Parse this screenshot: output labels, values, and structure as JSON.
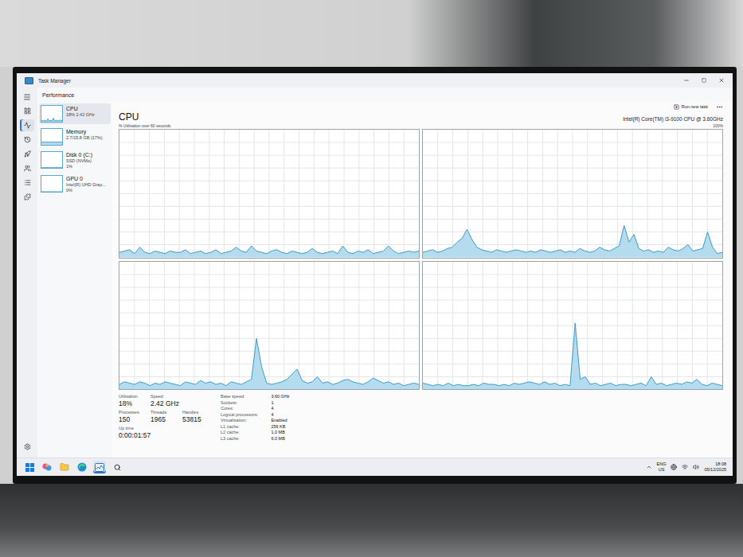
{
  "window": {
    "title": "Task Manager"
  },
  "header": {
    "title": "Performance",
    "run_new_task": "Run new task"
  },
  "nav": [
    {
      "selected": false
    },
    {
      "selected": true
    },
    {
      "selected": false
    },
    {
      "selected": false
    },
    {
      "selected": false
    },
    {
      "selected": false
    },
    {
      "selected": false
    }
  ],
  "resources": [
    {
      "name": "CPU",
      "details": [
        "18% 2.42 GHz"
      ],
      "selected": true,
      "values": [
        5,
        8,
        4,
        10,
        6,
        5,
        18,
        7,
        6,
        9,
        5,
        22,
        8,
        6,
        10,
        7,
        5,
        12,
        6,
        8
      ]
    },
    {
      "name": "Memory",
      "details": [
        "2.7/15.8 GB (17%)"
      ],
      "selected": false,
      "values": [
        17,
        17,
        17,
        17,
        17,
        17,
        17,
        17,
        17,
        17,
        17,
        17,
        17,
        17,
        17,
        17,
        17,
        17,
        17,
        17
      ]
    },
    {
      "name": "Disk 0 (C:)",
      "details": [
        "SSD (NVMe)",
        "1%"
      ],
      "selected": false,
      "values": [
        1,
        1,
        2,
        1,
        1,
        3,
        1,
        1,
        1,
        2,
        1,
        1,
        1,
        1,
        4,
        1,
        1,
        1,
        2,
        1
      ]
    },
    {
      "name": "GPU 0",
      "details": [
        "Intel(R) UHD Grap...",
        "0%"
      ],
      "selected": false,
      "values": [
        0,
        0,
        0,
        0,
        0,
        0,
        0,
        0,
        0,
        0,
        0,
        0,
        0,
        0,
        0,
        0,
        0,
        0,
        0,
        0
      ]
    }
  ],
  "cpu": {
    "title": "CPU",
    "subtitle": "% Utilisation over 60 seconds",
    "model": "Intel(R) Core(TM) i3-9100 CPU @ 3.60GHz",
    "max_label": "100%",
    "cores": [
      {
        "values": [
          4,
          5,
          6,
          3,
          8,
          4,
          3,
          5,
          4,
          3,
          5,
          4,
          4,
          6,
          3,
          4,
          5,
          3,
          4,
          6,
          3,
          4,
          5,
          8,
          5,
          4,
          9,
          5,
          4,
          3,
          5,
          6,
          4,
          3,
          5,
          4,
          3,
          4,
          7,
          4,
          3,
          4,
          5,
          3,
          9,
          4,
          3,
          5,
          4,
          6,
          3,
          4,
          5,
          9,
          5,
          3,
          4,
          5,
          4,
          5
        ]
      },
      {
        "values": [
          4,
          5,
          6,
          4,
          5,
          7,
          8,
          12,
          15,
          22,
          14,
          8,
          6,
          5,
          4,
          6,
          5,
          4,
          5,
          6,
          5,
          4,
          5,
          4,
          6,
          5,
          4,
          5,
          6,
          4,
          5,
          4,
          7,
          5,
          4,
          5,
          8,
          6,
          5,
          7,
          9,
          25,
          12,
          18,
          7,
          5,
          6,
          4,
          5,
          4,
          8,
          6,
          5,
          7,
          10,
          5,
          6,
          7,
          20,
          8,
          3,
          4
        ]
      },
      {
        "values": [
          4,
          6,
          5,
          4,
          6,
          5,
          3,
          5,
          4,
          6,
          5,
          4,
          3,
          6,
          5,
          4,
          7,
          5,
          6,
          4,
          5,
          3,
          6,
          5,
          4,
          6,
          8,
          40,
          18,
          5,
          4,
          5,
          6,
          8,
          12,
          16,
          7,
          5,
          6,
          10,
          5,
          6,
          4,
          5,
          7,
          8,
          6,
          5,
          4,
          6,
          9,
          7,
          5,
          6,
          4,
          5,
          3,
          4,
          5,
          4
        ]
      },
      {
        "values": [
          5,
          4,
          3,
          4,
          3,
          5,
          3,
          4,
          3,
          3,
          4,
          3,
          5,
          4,
          4,
          3,
          4,
          3,
          5,
          4,
          5,
          6,
          5,
          4,
          6,
          4,
          5,
          3,
          4,
          3,
          52,
          8,
          10,
          4,
          5,
          3,
          4,
          5,
          3,
          4,
          4,
          3,
          4,
          5,
          3,
          10,
          4,
          5,
          3,
          4,
          5,
          4,
          6,
          5,
          8,
          4,
          3,
          5,
          4,
          3
        ]
      }
    ],
    "stats": [
      [
        {
          "label": "Utilisation",
          "value": "18%"
        },
        {
          "label": "Speed",
          "value": "2.42 GHz"
        }
      ],
      [
        {
          "label": "Processes",
          "value": "150"
        },
        {
          "label": "Threads",
          "value": "1965"
        },
        {
          "label": "Handles",
          "value": "53815"
        }
      ],
      [
        {
          "label": "Up time",
          "value": "0:00:01:57"
        }
      ]
    ],
    "specs": [
      {
        "label": "Base speed:",
        "value": "3.60 GHz"
      },
      {
        "label": "Sockets:",
        "value": "1"
      },
      {
        "label": "Cores:",
        "value": "4"
      },
      {
        "label": "Logical processors:",
        "value": "4"
      },
      {
        "label": "Virtualisation:",
        "value": "Enabled"
      },
      {
        "label": "L1 cache:",
        "value": "256 KB"
      },
      {
        "label": "L2 cache:",
        "value": "1.0 MB"
      },
      {
        "label": "L3 cache:",
        "value": "6.0 MB"
      }
    ]
  },
  "taskbar": {
    "apps": [
      {
        "selected": false
      },
      {
        "selected": false
      },
      {
        "selected": false
      },
      {
        "selected": false
      },
      {
        "selected": true
      }
    ],
    "language": "ENG",
    "region": "US",
    "time": "18:08",
    "date": "05/12/2025"
  }
}
